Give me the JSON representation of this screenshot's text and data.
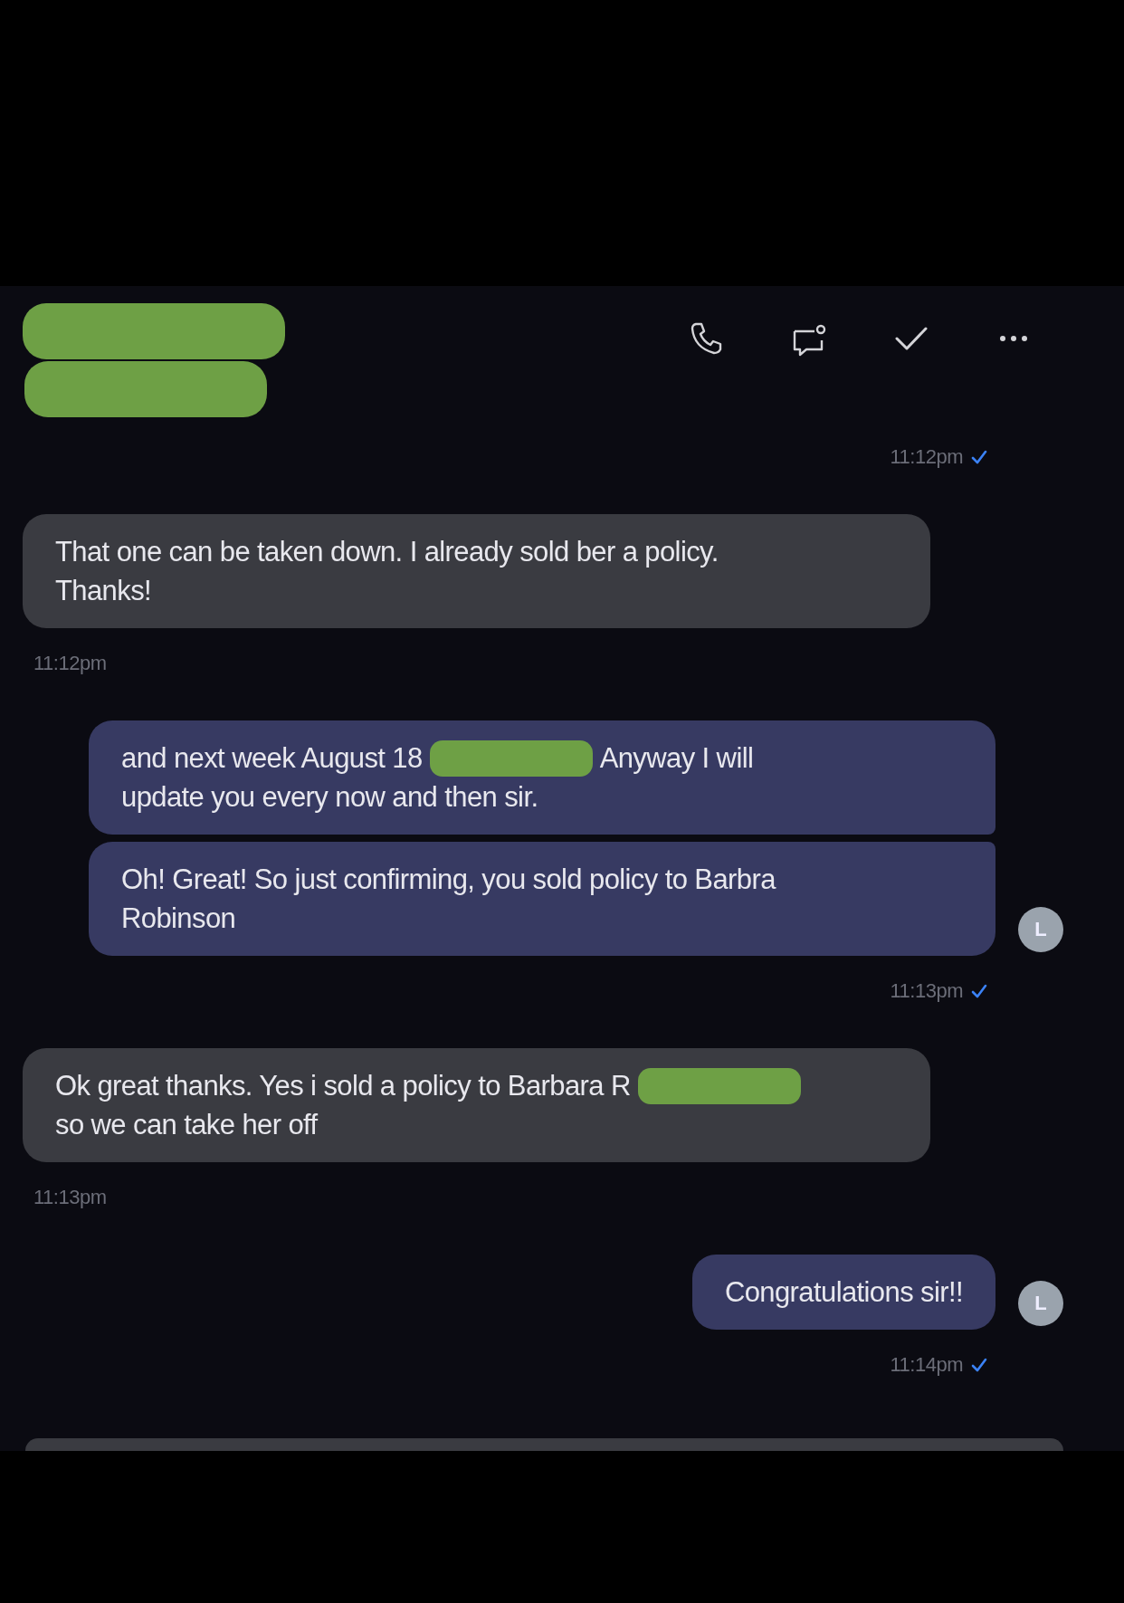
{
  "header": {
    "contact_redacted": true,
    "actions": [
      {
        "kind": "call"
      },
      {
        "kind": "chat"
      },
      {
        "kind": "check"
      },
      {
        "kind": "more"
      }
    ]
  },
  "items": [
    {
      "kind": "time",
      "outgoing": true,
      "text": "11:12pm",
      "read": true
    },
    {
      "kind": "group",
      "outgoing": false,
      "messages": [
        {
          "lines": [
            [
              {
                "kind": "text",
                "text": "That one can be taken down. I already sold ber a policy."
              }
            ],
            [
              {
                "kind": "text",
                "text": "Thanks!"
              }
            ]
          ]
        }
      ]
    },
    {
      "kind": "time",
      "outgoing": false,
      "text": "11:12pm",
      "read": false
    },
    {
      "kind": "group",
      "outgoing": true,
      "avatar": "L",
      "messages": [
        {
          "lines": [
            [
              {
                "kind": "text",
                "text": "and next week August 18"
              },
              {
                "kind": "redaction"
              },
              {
                "kind": "text",
                "text": "Anyway I will"
              }
            ],
            [
              {
                "kind": "text",
                "text": "update you every now and then sir."
              }
            ]
          ]
        },
        {
          "lines": [
            [
              {
                "kind": "text",
                "text": "Oh! Great! So just confirming, you sold policy to Barbra"
              }
            ],
            [
              {
                "kind": "text",
                "text": "Robinson"
              }
            ]
          ]
        }
      ]
    },
    {
      "kind": "time",
      "outgoing": true,
      "text": "11:13pm",
      "read": true
    },
    {
      "kind": "group",
      "outgoing": false,
      "messages": [
        {
          "lines": [
            [
              {
                "kind": "text",
                "text": "Ok great thanks. Yes i sold a policy to Barbara R"
              },
              {
                "kind": "redaction"
              }
            ],
            [
              {
                "kind": "text",
                "text": "so we can take her off"
              }
            ]
          ]
        }
      ]
    },
    {
      "kind": "time",
      "outgoing": false,
      "text": "11:13pm",
      "read": false
    },
    {
      "kind": "group",
      "outgoing": true,
      "avatar": "L",
      "messages": [
        {
          "lines": [
            [
              {
                "kind": "text",
                "text": "Congratulations sir!!"
              }
            ]
          ]
        }
      ]
    },
    {
      "kind": "time",
      "outgoing": true,
      "text": "11:14pm",
      "read": true
    }
  ],
  "composer": {
    "visible": true
  }
}
